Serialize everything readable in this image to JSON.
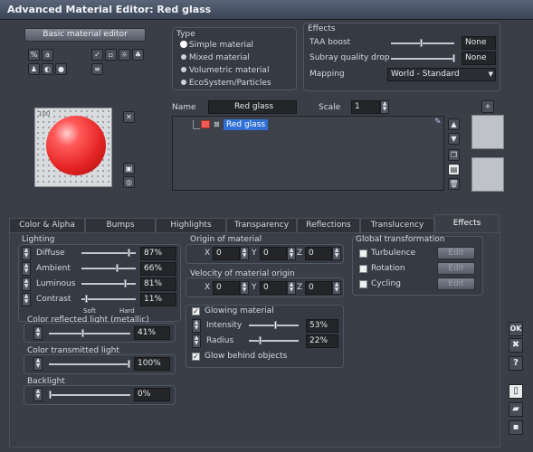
{
  "window": {
    "title": "Advanced Material Editor: Red glass"
  },
  "basic_editor_button": "Basic material editor",
  "type_group": {
    "title": "Type",
    "options": [
      "Simple material",
      "Mixed material",
      "Volumetric material",
      "EcoSystem/Particles"
    ],
    "selected": 0
  },
  "effects_group": {
    "title": "Effects",
    "taa_label": "TAA boost",
    "taa_value": "None",
    "subray_label": "Subray quality drop",
    "subray_value": "None",
    "mapping_label": "Mapping",
    "mapping_value": "World - Standard"
  },
  "name_row": {
    "name_label": "Name",
    "name_value": "Red glass",
    "scale_label": "Scale",
    "scale_value": "1"
  },
  "tree": {
    "item_label": "Red glass"
  },
  "tabs": [
    "Color & Alpha",
    "Bumps",
    "Highlights",
    "Transparency",
    "Reflections",
    "Translucency",
    "Effects"
  ],
  "active_tab": 6,
  "lighting": {
    "title": "Lighting",
    "rows": [
      {
        "label": "Diffuse",
        "value": "87%",
        "level": 0.87
      },
      {
        "label": "Ambient",
        "value": "66%",
        "level": 0.66
      },
      {
        "label": "Luminous",
        "value": "81%",
        "level": 0.81
      },
      {
        "label": "Contrast",
        "value": "11%",
        "level": 0.11
      }
    ],
    "soft_label": "Soft",
    "hard_label": "Hard"
  },
  "color_reflected": {
    "title": "Color reflected light (metallic)",
    "value": "41%",
    "level": 0.41
  },
  "color_transmitted": {
    "title": "Color transmitted light",
    "value": "100%",
    "level": 1.0
  },
  "backlight": {
    "title": "Backlight",
    "value": "0%",
    "level": 0.0
  },
  "origin": {
    "title": "Origin of material",
    "x_label": "X",
    "x": "0",
    "y_label": "Y",
    "y": "0",
    "z_label": "Z",
    "z": "0"
  },
  "velocity": {
    "title": "Velocity of material origin",
    "x_label": "X",
    "x": "0",
    "y_label": "Y",
    "y": "0",
    "z_label": "Z",
    "z": "0"
  },
  "glowing": {
    "title": "Glowing material",
    "intensity_label": "Intensity",
    "intensity_value": "53%",
    "intensity_level": 0.53,
    "radius_label": "Radius",
    "radius_value": "22%",
    "radius_level": 0.22,
    "behind_label": "Glow behind objects"
  },
  "global_transform": {
    "title": "Global transformation",
    "rows": [
      {
        "label": "Turbulence",
        "edit": "Edit"
      },
      {
        "label": "Rotation",
        "edit": "Edit"
      },
      {
        "label": "Cycling",
        "edit": "Edit"
      }
    ]
  },
  "side_buttons": {
    "ok": "OK",
    "cancel": "✖",
    "help": "?"
  },
  "preview_badge": "100",
  "colors": {
    "accent": "#2f6fd6",
    "sphere": "#f23b3b"
  }
}
